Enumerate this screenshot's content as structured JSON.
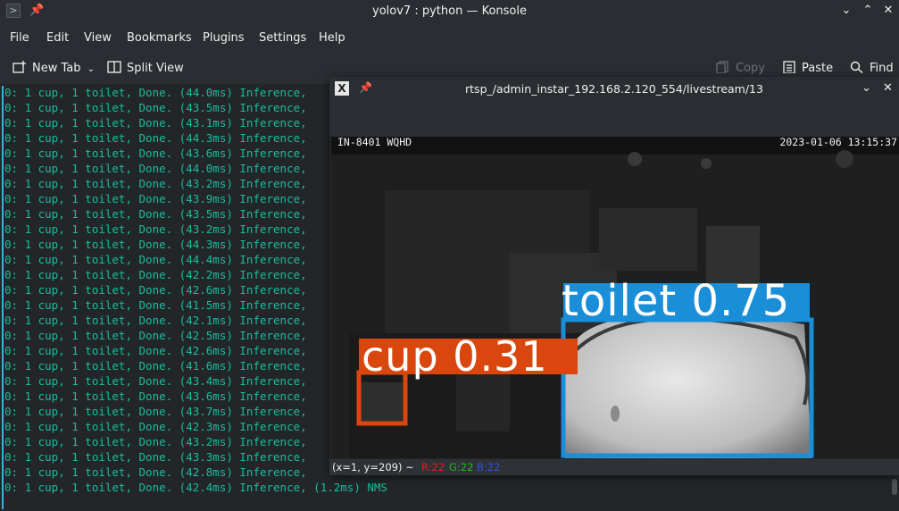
{
  "window": {
    "title": "yolov7 : python — Konsole",
    "controls": [
      "chevron-down",
      "chevron-up",
      "close"
    ]
  },
  "menu": [
    "File",
    "Edit",
    "View",
    "Bookmarks",
    "Plugins",
    "Settings",
    "Help"
  ],
  "toolbar": {
    "new_tab": "New Tab",
    "split_view": "Split View",
    "copy": "Copy",
    "paste": "Paste",
    "find": "Find"
  },
  "terminal": {
    "lines": [
      "0: 1 cup, 1 toilet, Done. (44.0ms) Inference,",
      "0: 1 cup, 1 toilet, Done. (43.5ms) Inference,",
      "0: 1 cup, 1 toilet, Done. (43.1ms) Inference,",
      "0: 1 cup, 1 toilet, Done. (44.3ms) Inference,",
      "0: 1 cup, 1 toilet, Done. (43.6ms) Inference,",
      "0: 1 cup, 1 toilet, Done. (44.0ms) Inference,",
      "0: 1 cup, 1 toilet, Done. (43.2ms) Inference,",
      "0: 1 cup, 1 toilet, Done. (43.9ms) Inference,",
      "0: 1 cup, 1 toilet, Done. (43.5ms) Inference,",
      "0: 1 cup, 1 toilet, Done. (43.2ms) Inference,",
      "0: 1 cup, 1 toilet, Done. (44.3ms) Inference,",
      "0: 1 cup, 1 toilet, Done. (44.4ms) Inference,",
      "0: 1 cup, 1 toilet, Done. (42.2ms) Inference,",
      "0: 1 cup, 1 toilet, Done. (42.6ms) Inference,",
      "0: 1 cup, 1 toilet, Done. (41.5ms) Inference,",
      "0: 1 cup, 1 toilet, Done. (42.1ms) Inference,",
      "0: 1 cup, 1 toilet, Done. (42.5ms) Inference,",
      "0: 1 cup, 1 toilet, Done. (42.6ms) Inference,",
      "0: 1 cup, 1 toilet, Done. (41.6ms) Inference,",
      "0: 1 cup, 1 toilet, Done. (43.4ms) Inference,",
      "0: 1 cup, 1 toilet, Done. (43.6ms) Inference,",
      "0: 1 cup, 1 toilet, Done. (43.7ms) Inference,",
      "0: 1 cup, 1 toilet, Done. (42.3ms) Inference,",
      "0: 1 cup, 1 toilet, Done. (43.2ms) Inference,",
      "0: 1 cup, 1 toilet, Done. (43.3ms) Inference,",
      "0: 1 cup, 1 toilet, Done. (42.8ms) Inference,",
      "0: 1 cup, 1 toilet, Done. (42.4ms) Inference, (1.2ms) NMS"
    ],
    "text_color": "#1abc9c"
  },
  "image_window": {
    "title": "rtsp_/admin_instar_192.168.2.120_554/livestream/13",
    "osd_left": "IN-8401 WQHD",
    "osd_right": "2023-01-06 13:15:37",
    "detections": [
      {
        "label": "toilet 0.75",
        "color": "#1a8fd8"
      },
      {
        "label": "cup 0.31",
        "color": "#d9470f"
      }
    ],
    "status": {
      "coords": "(x=1, y=209) ~",
      "r": "R:22",
      "g": "G:22",
      "b": "B:22"
    }
  }
}
